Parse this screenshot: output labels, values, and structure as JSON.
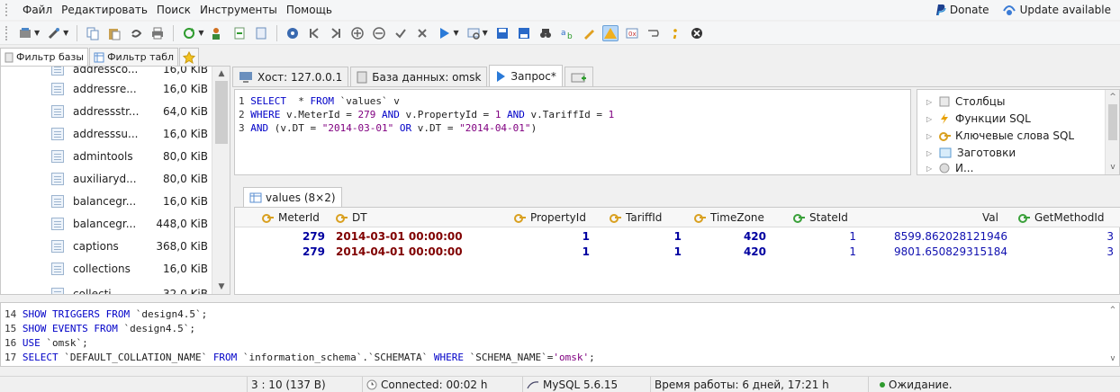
{
  "menu": [
    "Файл",
    "Редактировать",
    "Поиск",
    "Инструменты",
    "Помощь"
  ],
  "menu_right": {
    "donate": "Donate",
    "update": "Update available"
  },
  "left_tabs": [
    "Фильтр базы",
    "Фильтр табл"
  ],
  "tree_partial_top": {
    "name": "addressco...",
    "size": "16,0 KiB"
  },
  "tree_items": [
    {
      "name": "addressre...",
      "size": "16,0 KiB"
    },
    {
      "name": "addressstr...",
      "size": "64,0 KiB"
    },
    {
      "name": "addresssu...",
      "size": "16,0 KiB"
    },
    {
      "name": "admintools",
      "size": "80,0 KiB"
    },
    {
      "name": "auxiliaryd...",
      "size": "80,0 KiB"
    },
    {
      "name": "balancegr...",
      "size": "16,0 KiB"
    },
    {
      "name": "balancegr...",
      "size": "448,0 KiB"
    },
    {
      "name": "captions",
      "size": "368,0 KiB"
    },
    {
      "name": "collections",
      "size": "16,0 KiB"
    }
  ],
  "tree_partial_bottom": {
    "name": "collecti...",
    "size": "32,0 KiB"
  },
  "main_tabs": {
    "host": "Хост: 127.0.0.1",
    "database": "База данных: omsk",
    "query": "Запрос*"
  },
  "query_lines": [
    {
      "n": "1",
      "parts": [
        [
          "kw",
          "SELECT"
        ],
        [
          "",
          "  * "
        ],
        [
          "kw",
          "FROM"
        ],
        [
          "",
          " `values` v"
        ]
      ]
    },
    {
      "n": "2",
      "parts": [
        [
          "kw",
          "WHERE"
        ],
        [
          "",
          " v.MeterId = "
        ],
        [
          "num",
          "279"
        ],
        [
          "",
          " "
        ],
        [
          "kw",
          "AND"
        ],
        [
          "",
          " v.PropertyId = "
        ],
        [
          "num",
          "1"
        ],
        [
          "",
          " "
        ],
        [
          "kw",
          "AND"
        ],
        [
          "",
          " v.TariffId = "
        ],
        [
          "num",
          "1"
        ]
      ]
    },
    {
      "n": "3",
      "parts": [
        [
          "kw",
          "AND"
        ],
        [
          "",
          " (v.DT = "
        ],
        [
          "str",
          "\"2014-03-01\""
        ],
        [
          "",
          " "
        ],
        [
          "kw",
          "OR"
        ],
        [
          "",
          " v.DT = "
        ],
        [
          "str",
          "\"2014-04-01\""
        ],
        [
          "",
          ")"
        ]
      ]
    }
  ],
  "helper_items": [
    "Столбцы",
    "Функции SQL",
    "Ключевые слова SQL",
    "Заготовки",
    "И..."
  ],
  "result_tab": "values (8×2)",
  "columns": [
    "MeterId",
    "DT",
    "PropertyId",
    "TariffId",
    "TimeZone",
    "StateId",
    "Val",
    "GetMethodId"
  ],
  "rows": [
    [
      "279",
      "2014-03-01 00:00:00",
      "1",
      "1",
      "420",
      "1",
      "8599.862028121946",
      "3"
    ],
    [
      "279",
      "2014-04-01 00:00:00",
      "1",
      "1",
      "420",
      "1",
      "9801.650829315184",
      "3"
    ]
  ],
  "log_lines": [
    {
      "n": "14",
      "parts": [
        [
          "kw",
          "SHOW TRIGGERS FROM"
        ],
        [
          "",
          " `design4.5`;"
        ]
      ]
    },
    {
      "n": "15",
      "parts": [
        [
          "kw",
          "SHOW EVENTS FROM"
        ],
        [
          "",
          " `design4.5`;"
        ]
      ]
    },
    {
      "n": "16",
      "parts": [
        [
          "kw",
          "USE"
        ],
        [
          "",
          " `omsk`;"
        ]
      ]
    },
    {
      "n": "17",
      "parts": [
        [
          "kw",
          "SELECT"
        ],
        [
          "",
          " `DEFAULT_COLLATION_NAME` "
        ],
        [
          "kw",
          "FROM"
        ],
        [
          "",
          " `information_schema`.`SCHEMATA` "
        ],
        [
          "kw",
          "WHERE"
        ],
        [
          "",
          " `SCHEMA_NAME`="
        ],
        [
          "str",
          "'omsk'"
        ],
        [
          "",
          ";"
        ]
      ]
    }
  ],
  "status": {
    "position": "3 : 10 (137 B)",
    "connected": "Connected: 00:02 h",
    "server": "MySQL 5.6.15",
    "uptime": "Время работы: 6 дней, 17:21 h",
    "state": "Ожидание."
  },
  "colors": {
    "keyword": "#0000c8",
    "string": "#800080",
    "bold_red": "#800000",
    "bold_blue": "#0000a0"
  }
}
